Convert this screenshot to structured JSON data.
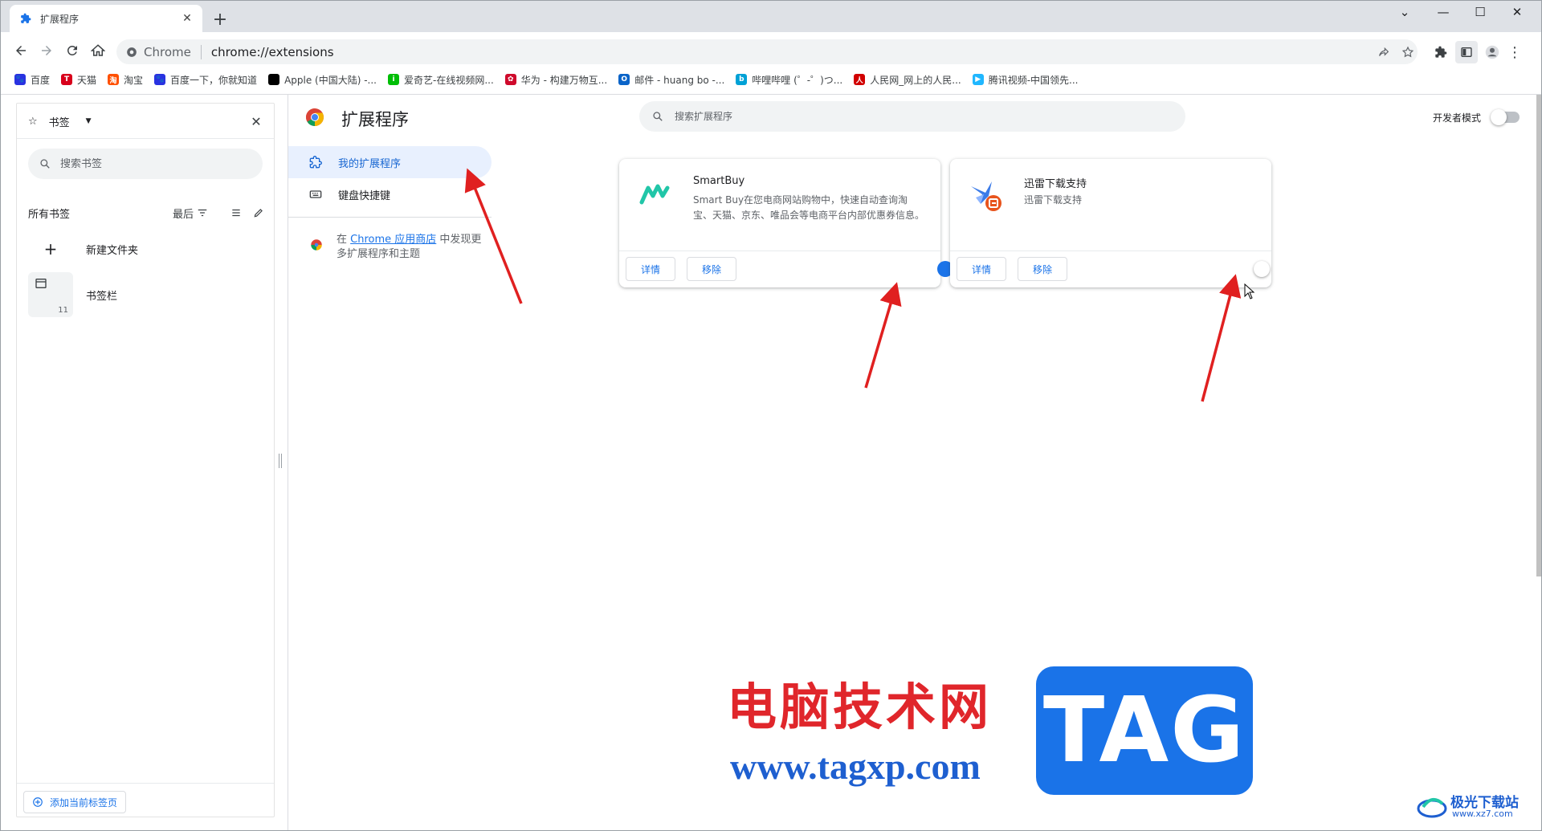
{
  "browser": {
    "tab_title": "扩展程序",
    "omnibox_site": "Chrome",
    "omnibox_url": "chrome://extensions"
  },
  "bookmarks": [
    {
      "label": "百度",
      "icon": "baidu-paw-icon",
      "color": "#2932e1"
    },
    {
      "label": "天猫",
      "icon": "tmall-icon",
      "color": "#d8001b"
    },
    {
      "label": "淘宝",
      "icon": "taobao-icon",
      "color": "#ff5000"
    },
    {
      "label": "百度一下，你就知道",
      "icon": "baidu-paw-icon",
      "color": "#2932e1"
    },
    {
      "label": "Apple (中国大陆) -...",
      "icon": "apple-icon",
      "color": "#000000"
    },
    {
      "label": "爱奇艺-在线视频网...",
      "icon": "iqiyi-icon",
      "color": "#00be06"
    },
    {
      "label": "华为 - 构建万物互...",
      "icon": "huawei-icon",
      "color": "#cf0a2c"
    },
    {
      "label": "邮件 - huang bo -...",
      "icon": "outlook-icon",
      "color": "#0a64c8"
    },
    {
      "label": "哔哩哔哩 (゜-゜)つ...",
      "icon": "bilibili-icon",
      "color": "#00a1d6"
    },
    {
      "label": "人民网_网上的人民...",
      "icon": "people-icon",
      "color": "#d10000"
    },
    {
      "label": "腾讯视频-中国领先...",
      "icon": "tencent-video-icon",
      "color": "#20b7ff"
    }
  ],
  "side_panel": {
    "selector": "书签",
    "search_placeholder": "搜索书签",
    "all_bookmarks": "所有书签",
    "sort": "最后",
    "new_folder": "新建文件夹",
    "bookmarks_bar": "书签栏",
    "bookmarks_bar_count": "11",
    "add_current_tab": "添加当前标签页"
  },
  "extensions_page": {
    "title": "扩展程序",
    "search_placeholder": "搜索扩展程序",
    "developer_mode": "开发者模式",
    "nav": {
      "my_extensions": "我的扩展程序",
      "keyboard_shortcuts": "键盘快捷键"
    },
    "store": {
      "prefix": "在",
      "link": "Chrome 应用商店",
      "suffix": "中发现更多扩展程序和主题"
    },
    "cards": [
      {
        "name": "SmartBuy",
        "description": "Smart Buy在您电商网站购物中，快速自动查询淘宝、天猫、京东、唯品会等电商平台内部优惠券信息。",
        "details": "详情",
        "remove": "移除",
        "enabled": true,
        "icon": "smartbuy-icon"
      },
      {
        "name": "迅雷下载支持",
        "description": "迅雷下载支持",
        "details": "详情",
        "remove": "移除",
        "enabled": false,
        "icon": "thunder-icon"
      }
    ]
  },
  "watermark": {
    "cn_text": "电脑技术网",
    "url": "www.tagxp.com",
    "tag": "TAG",
    "site2": "极光下载站",
    "site2_url": "www.xz7.com"
  },
  "colors": {
    "accent": "#1a73e8",
    "annotation_arrow": "#e02020",
    "active_nav_bg": "#e8f0fe"
  }
}
